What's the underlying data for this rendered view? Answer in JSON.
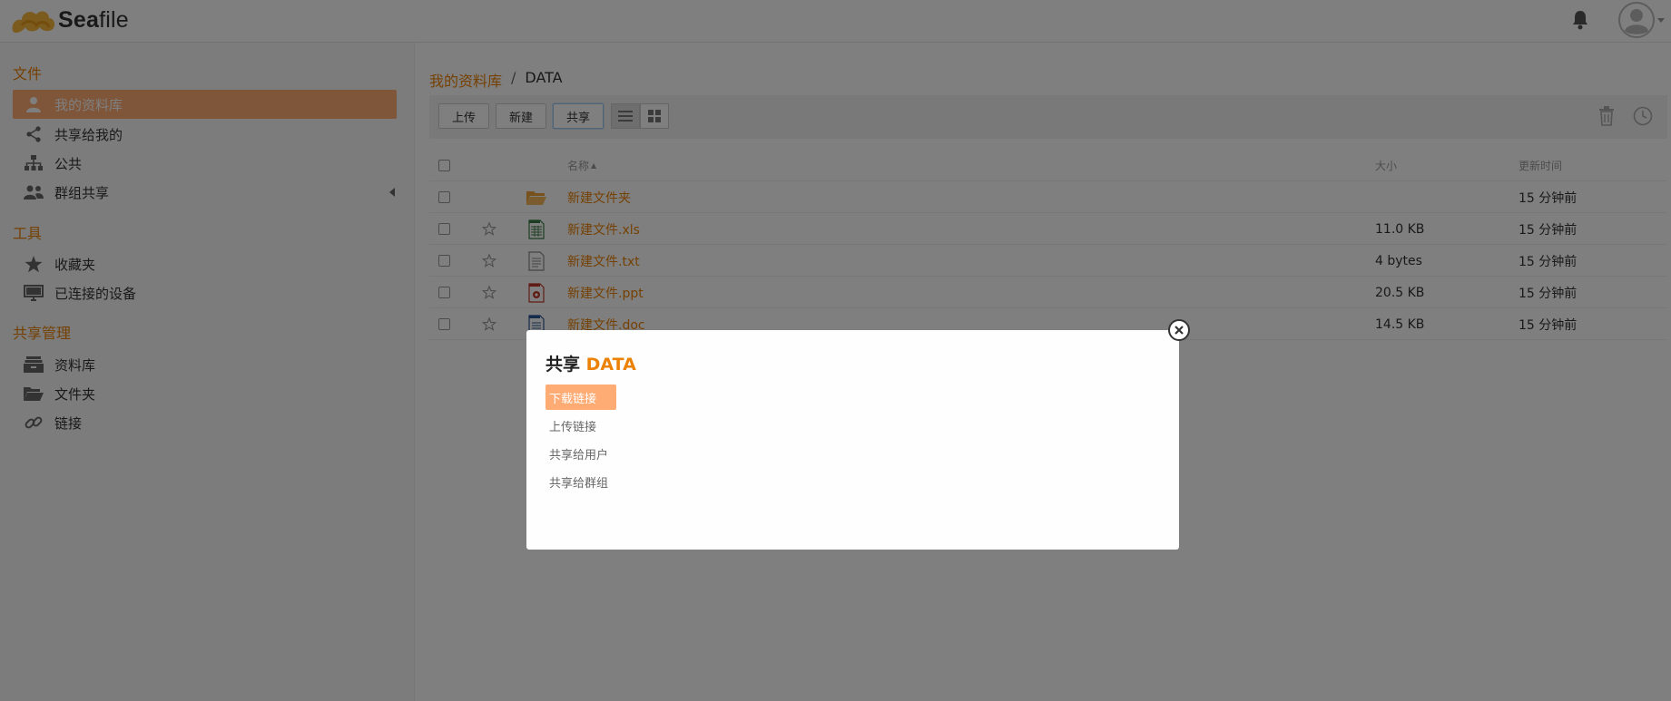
{
  "app": {
    "name_bold": "Sea",
    "name_rest": "file"
  },
  "sidebar": {
    "sections": [
      {
        "heading": "文件",
        "items": [
          {
            "label": "我的资料库",
            "icon": "user-icon",
            "active": true
          },
          {
            "label": "共享给我的",
            "icon": "share-icon"
          },
          {
            "label": "公共",
            "icon": "org-chart-icon"
          },
          {
            "label": "群组共享",
            "icon": "group-icon",
            "has_caret": true
          }
        ]
      },
      {
        "heading": "工具",
        "items": [
          {
            "label": "收藏夹",
            "icon": "star-icon"
          },
          {
            "label": "已连接的设备",
            "icon": "monitor-icon"
          }
        ]
      },
      {
        "heading": "共享管理",
        "items": [
          {
            "label": "资料库",
            "icon": "library-icon"
          },
          {
            "label": "文件夹",
            "icon": "folder-open-icon"
          },
          {
            "label": "链接",
            "icon": "link-icon"
          }
        ]
      }
    ]
  },
  "breadcrumb": {
    "root": "我的资料库",
    "sep": "/",
    "current": "DATA"
  },
  "toolbar": {
    "upload": "上传",
    "new": "新建",
    "share": "共享"
  },
  "table": {
    "headers": {
      "name": "名称",
      "sort_indicator": "▲",
      "size": "大小",
      "modified": "更新时间"
    },
    "rows": [
      {
        "name": "新建文件夹",
        "type": "folder",
        "size": "",
        "modified": "15 分钟前",
        "starrable": false
      },
      {
        "name": "新建文件.xls",
        "type": "xls",
        "size": "11.0 KB",
        "modified": "15 分钟前",
        "starrable": true
      },
      {
        "name": "新建文件.txt",
        "type": "txt",
        "size": "4 bytes",
        "modified": "15 分钟前",
        "starrable": true
      },
      {
        "name": "新建文件.ppt",
        "type": "ppt",
        "size": "20.5 KB",
        "modified": "15 分钟前",
        "starrable": true
      },
      {
        "name": "新建文件.doc",
        "type": "doc",
        "size": "14.5 KB",
        "modified": "15 分钟前",
        "starrable": true
      }
    ]
  },
  "dialog": {
    "title_prefix": "共享",
    "title_item": "DATA",
    "nav": [
      {
        "label": "下载链接",
        "active": true
      },
      {
        "label": "上传链接"
      },
      {
        "label": "共享给用户"
      },
      {
        "label": "共享给群组"
      }
    ]
  },
  "colors": {
    "accent": "#eb8205",
    "active_bg": "#feac74",
    "overlay": "rgba(0,0,0,0.5)"
  }
}
